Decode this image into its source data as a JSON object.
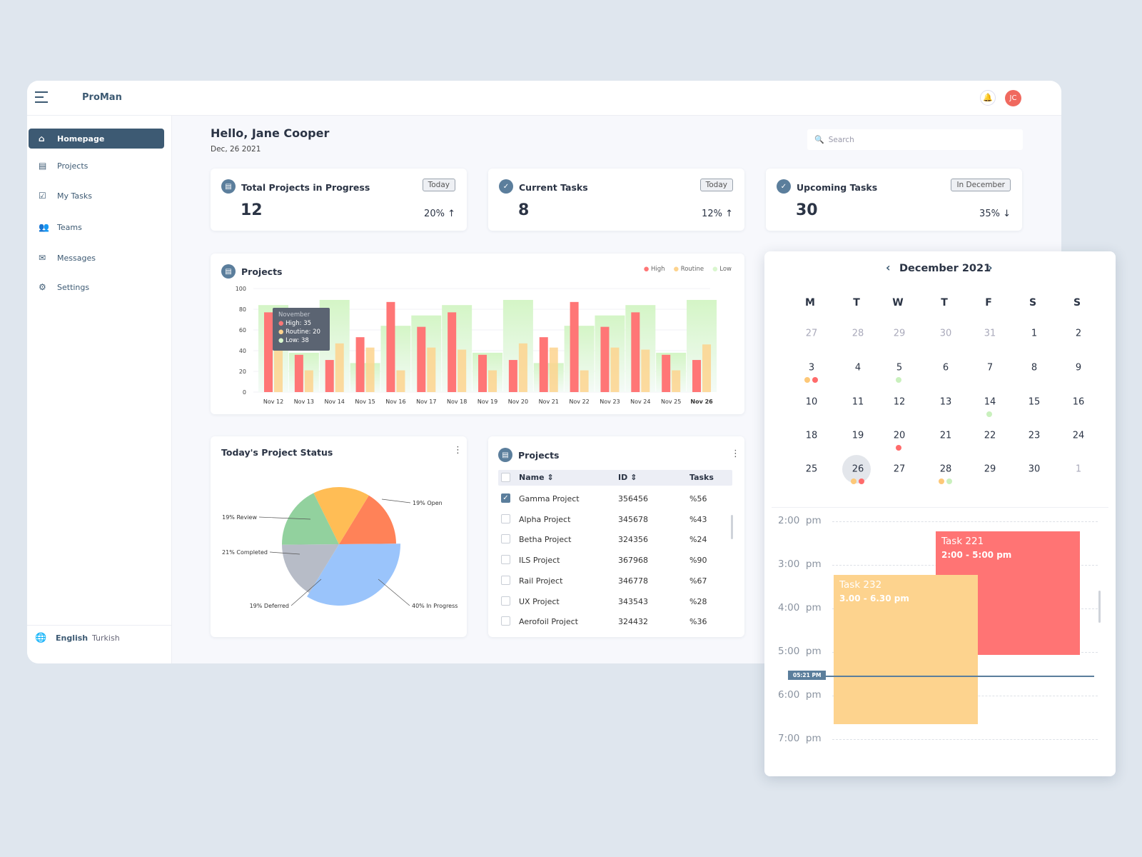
{
  "app": {
    "title": "ProMan",
    "avatar": "JC",
    "colors": {
      "primary": "#3d5a73",
      "high": "#ff7676",
      "routine": "#fdd38e",
      "low": "#d9f6ce",
      "avatar": "#f0695f"
    }
  },
  "sidebar": {
    "items": [
      {
        "label": "Homepage",
        "icon": "home-icon",
        "active": true
      },
      {
        "label": "Projects",
        "icon": "document-icon"
      },
      {
        "label": "My Tasks",
        "icon": "checkbox-icon"
      },
      {
        "label": "Teams",
        "icon": "users-icon"
      },
      {
        "label": "Messages",
        "icon": "envelope-icon"
      },
      {
        "label": "Settings",
        "icon": "gear-icon"
      }
    ],
    "languages": [
      "English",
      "Turkish"
    ]
  },
  "header": {
    "greeting": "Hello, Jane Cooper",
    "date": "Dec, 26 2021",
    "search_placeholder": "Search"
  },
  "stats": [
    {
      "title": "Total Projects in Progress",
      "badge": "Today",
      "value": "12",
      "change": "20%",
      "dir": "↑"
    },
    {
      "title": "Current Tasks",
      "badge": "Today",
      "value": "8",
      "change": "12%",
      "dir": "↑"
    },
    {
      "title": "Upcoming Tasks",
      "badge": "In December",
      "value": "30",
      "change": "35%",
      "dir": "↓"
    }
  ],
  "chart_data": {
    "type": "bar",
    "title": "Projects",
    "categories": [
      "Nov 12",
      "Nov 13",
      "Nov 14",
      "Nov 15",
      "Nov 16",
      "Nov 17",
      "Nov 18",
      "Nov 19",
      "Nov 20",
      "Nov 21",
      "Nov 22",
      "Nov 23",
      "Nov 24",
      "Nov 25",
      "Nov 26"
    ],
    "series": [
      {
        "name": "High",
        "values": [
          77,
          36,
          31,
          53,
          87,
          63,
          77,
          36,
          31,
          53,
          87,
          63,
          77,
          36,
          31
        ]
      },
      {
        "name": "Routine",
        "values": [
          41,
          21,
          47,
          43,
          21,
          43,
          41,
          21,
          47,
          43,
          21,
          43,
          41,
          21,
          46
        ]
      },
      {
        "name": "Low",
        "values": [
          84,
          38,
          89,
          28,
          64,
          74,
          84,
          38,
          89,
          28,
          64,
          74,
          84,
          38,
          89
        ]
      }
    ],
    "ylim": [
      0,
      100
    ],
    "yticks": [
      0,
      20,
      40,
      60,
      80,
      100
    ],
    "legend": "top-right",
    "tooltip": {
      "title": "November",
      "lines": [
        "High: 35",
        "Routine: 20",
        "Low: 38"
      ]
    }
  },
  "status": {
    "title": "Today's Project Status",
    "slices": [
      {
        "label": "19% Open",
        "value": 19,
        "color": "#ff8258"
      },
      {
        "label": "40% In Progress",
        "value": 40,
        "color": "#9ac4fb"
      },
      {
        "label": "19% Deferred",
        "value": 19,
        "color": "#b7bcc7"
      },
      {
        "label": "21% Completed",
        "value": 21,
        "color": "#92d19e"
      },
      {
        "label": "19% Review",
        "value": 19,
        "color": "#ffbd55"
      }
    ]
  },
  "table": {
    "title": "Projects",
    "headers": [
      "Name",
      "ID",
      "Tasks"
    ],
    "rows": [
      {
        "name": "Gamma Project",
        "id": "356456",
        "tasks": "%56",
        "checked": true
      },
      {
        "name": "Alpha Project",
        "id": "345678",
        "tasks": "%43"
      },
      {
        "name": "Betha Project",
        "id": "324356",
        "tasks": "%24"
      },
      {
        "name": "ILS Project",
        "id": "367968",
        "tasks": "%90"
      },
      {
        "name": "Rail Project",
        "id": "346778",
        "tasks": "%67"
      },
      {
        "name": "UX Project",
        "id": "343543",
        "tasks": "%28"
      },
      {
        "name": "Aerofoil Project",
        "id": "324432",
        "tasks": "%36"
      }
    ]
  },
  "calendar": {
    "month": "December 2021",
    "dows": [
      "M",
      "T",
      "W",
      "T",
      "F",
      "S",
      "S"
    ],
    "weeks": [
      [
        "27",
        "28",
        "29",
        "30",
        "31",
        "1",
        "2"
      ],
      [
        "3",
        "4",
        "5",
        "6",
        "7",
        "8",
        "9"
      ],
      [
        "10",
        "11",
        "12",
        "13",
        "14",
        "15",
        "16"
      ],
      [
        "18",
        "19",
        "20",
        "21",
        "22",
        "23",
        "24"
      ],
      [
        "25",
        "26",
        "27",
        "28",
        "29",
        "30",
        "1"
      ]
    ],
    "selected": "26",
    "hours": [
      "2:00  pm",
      "3:00  pm",
      "4:00  pm",
      "5:00  pm",
      "6:00  pm",
      "7:00  pm"
    ],
    "now": "05:21 PM",
    "tasks": [
      {
        "title": "Task 221",
        "time": "2:00 - 5:00 pm",
        "color": "#ff7474"
      },
      {
        "title": "Task 232",
        "time": "3.00 - 6.30 pm",
        "color": "#fdd38e"
      }
    ]
  }
}
